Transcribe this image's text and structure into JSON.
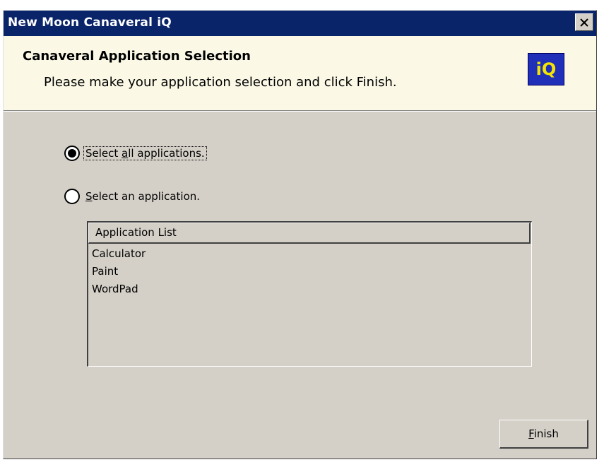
{
  "window": {
    "title": "New Moon Canaveral iQ"
  },
  "header": {
    "title": "Canaveral Application Selection",
    "subtitle": "Please make your application selection and click Finish.",
    "logo_text": "iQ"
  },
  "options": {
    "all": {
      "label_mnemonic_prefix": "Select ",
      "label_mnemonic_char": "a",
      "label_mnemonic_suffix": "ll applications.",
      "selected": true
    },
    "single": {
      "label_mnemonic_char": "S",
      "label_mnemonic_suffix": "elect an application.",
      "selected": false
    }
  },
  "list": {
    "header": "Application List",
    "items": [
      "Calculator",
      "Paint",
      "WordPad"
    ]
  },
  "buttons": {
    "finish_mnemonic_char": "F",
    "finish_suffix": "inish"
  },
  "colors": {
    "titlebar": "#0a246a",
    "header_bg": "#fbf9e6",
    "dialog_bg": "#d4d0c8",
    "logo_bg": "#1f2fb8",
    "logo_text": "#f4e500"
  }
}
